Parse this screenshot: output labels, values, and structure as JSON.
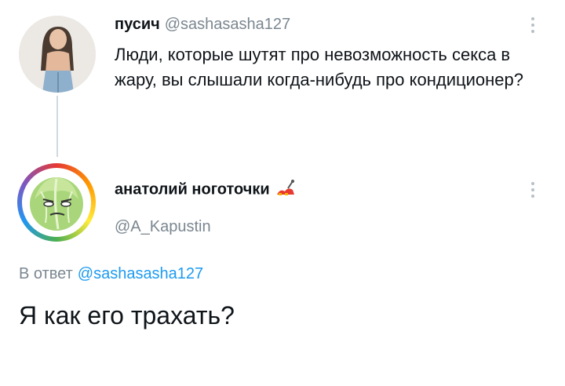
{
  "parent_tweet": {
    "display_name": "пусич",
    "handle": "@sashasasha127",
    "text": "Люди, которые шутят про невозможность секса в жару, вы слышали когда-нибудь про кондиционер?",
    "avatar_icon": "person-photo-avatar"
  },
  "reply_tweet": {
    "display_name": "анатолий ноготочки",
    "name_emoji_icon": "nail-polish-emoji",
    "handle": "@A_Kapustin",
    "avatar_icon": "cabbage-avatar",
    "reply_prefix": "В ответ",
    "reply_mention": "@sashasasha127",
    "text": "Я как его трахать?"
  },
  "colors": {
    "mention": "#1d9bf0",
    "secondary_text": "#7b8790",
    "thread_line": "#cfd9de"
  }
}
